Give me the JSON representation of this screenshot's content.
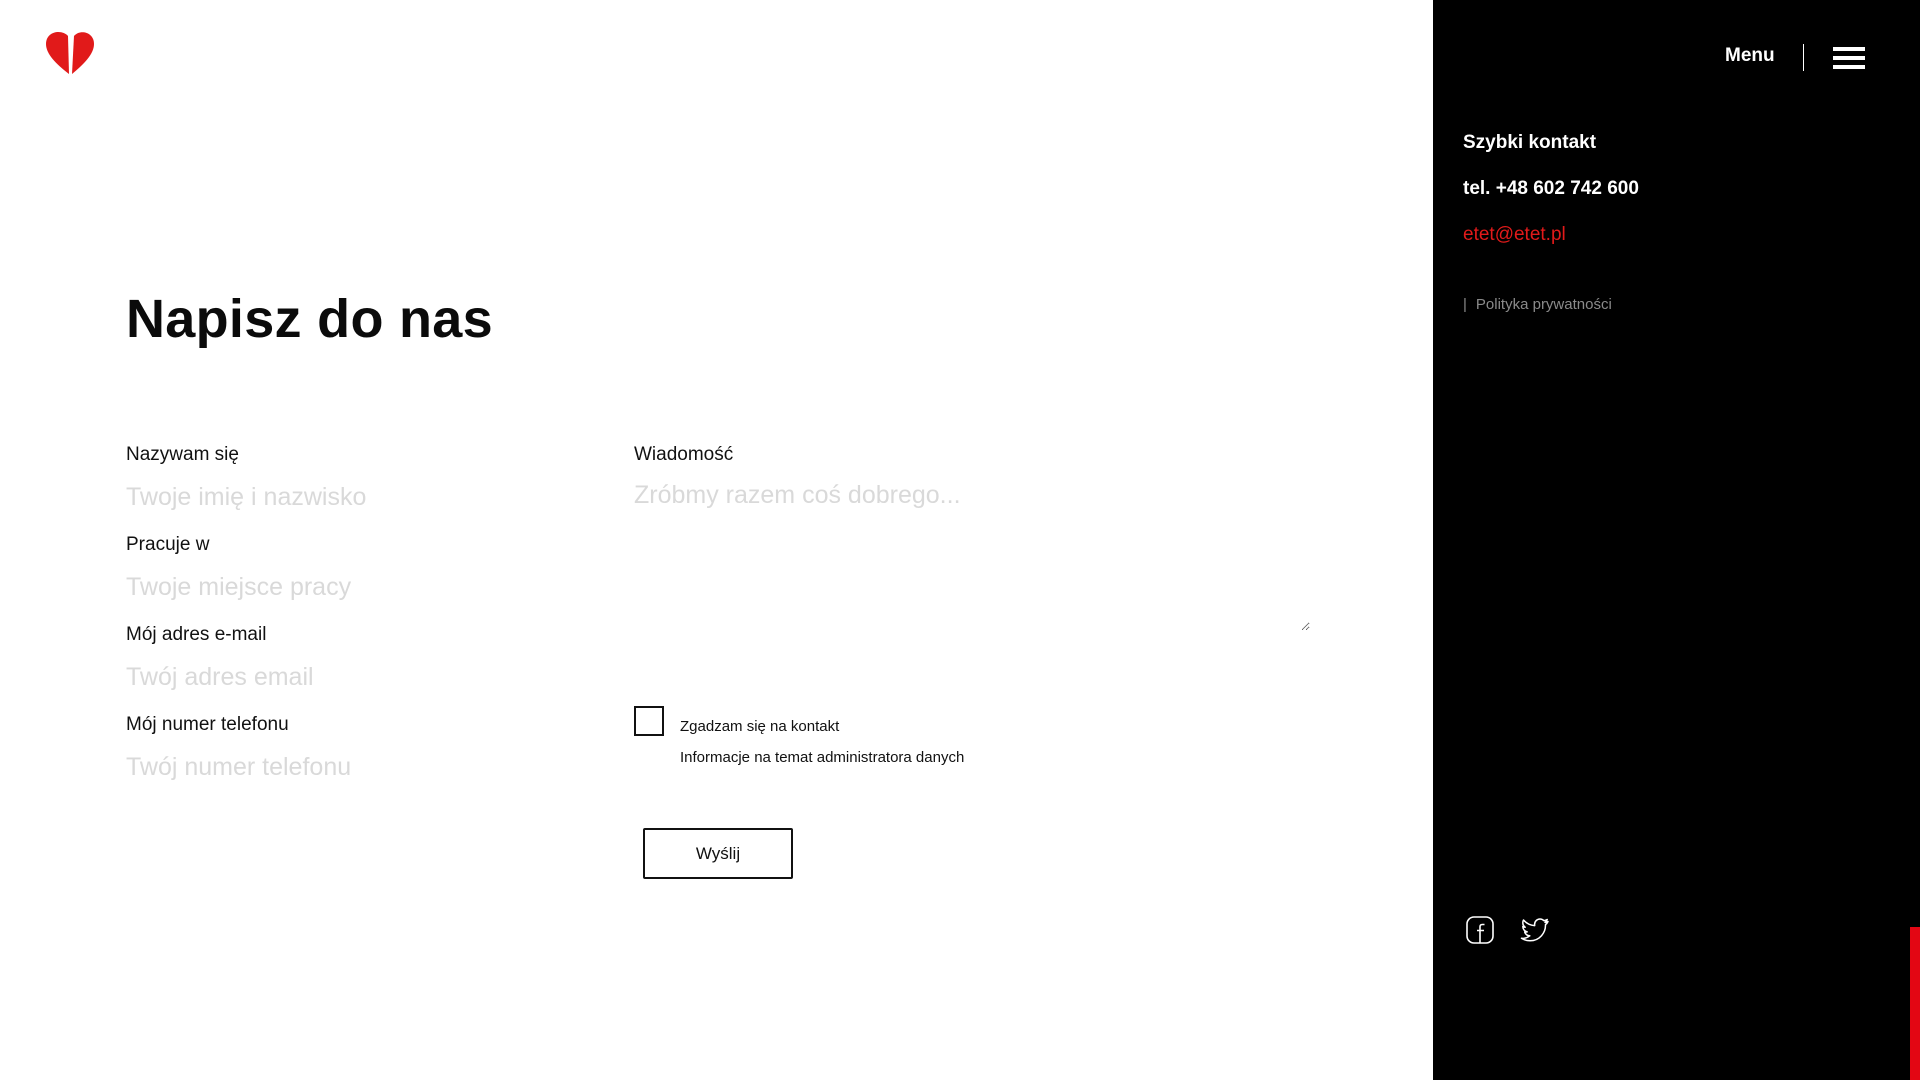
{
  "brand": {
    "accent_color": "#e11a1a",
    "logo_icon": "heart-logo-icon"
  },
  "main": {
    "title": "Napisz do nas",
    "fields": {
      "name": {
        "label": "Nazywam się",
        "placeholder": "Twoje imię i nazwisko"
      },
      "work": {
        "label": "Pracuje w",
        "placeholder": "Twoje miejsce pracy"
      },
      "email": {
        "label": "Mój adres e-mail",
        "placeholder": "Twój adres email"
      },
      "phone": {
        "label": "Mój numer telefonu",
        "placeholder": "Twój numer telefonu"
      },
      "message": {
        "label": "Wiadomość",
        "placeholder": "Zróbmy razem coś dobrego..."
      }
    },
    "consent": {
      "label": "Zgadzam się na kontakt",
      "info_link": "Informacje na temat administratora danych",
      "checked": false
    },
    "submit_label": "Wyślij"
  },
  "side_panel": {
    "menu_label": "Menu",
    "menu_icon": "hamburger-icon",
    "quick_contact_title": "Szybki kontakt",
    "phone": "tel. +48 602 742 600",
    "email": "etet@etet.pl",
    "privacy_separator": "|",
    "privacy_link": "Polityka prywatności",
    "social": [
      {
        "icon": "facebook-icon"
      },
      {
        "icon": "twitter-icon"
      }
    ]
  },
  "scrollbar": {
    "thumb_color": "#e30613"
  }
}
